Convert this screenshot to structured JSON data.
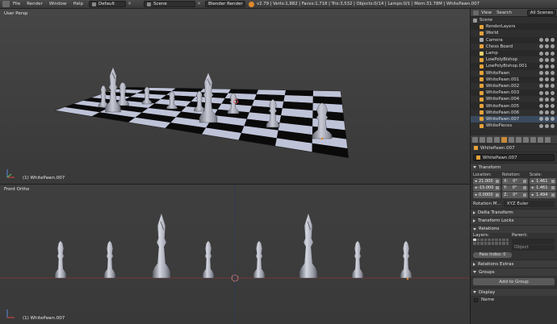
{
  "topbar": {
    "menus": [
      "File",
      "Render",
      "Window",
      "Help"
    ],
    "layout": "Default",
    "scene": "Scene",
    "engine": "Blender Render",
    "stats": "v2.79 | Verts:1,882 | Faces:1,718 | Tris:3,532 | Objects:0/14 | Lamps:0/1 | Mem:31.78M | WhitePawn.007"
  },
  "viewport_top": {
    "title": "User Persp",
    "footer": "(1) WhitePawn.007"
  },
  "viewport_bottom": {
    "title": "Front Ortho",
    "footer": "(1) WhitePawn.007"
  },
  "outliner": {
    "view_label": "View",
    "search_label": "Search",
    "scope": "All Scenes",
    "items": [
      {
        "label": "Scene",
        "kind": "scene",
        "indent": 0
      },
      {
        "label": "RenderLayers",
        "kind": "layer",
        "indent": 1
      },
      {
        "label": "World",
        "kind": "world",
        "indent": 1
      },
      {
        "label": "Camera",
        "kind": "cam",
        "indent": 1
      },
      {
        "label": "Chess Board",
        "kind": "obj",
        "indent": 1
      },
      {
        "label": "Lamp",
        "kind": "lamp",
        "indent": 1
      },
      {
        "label": "LowPolyBishop",
        "kind": "obj",
        "indent": 1
      },
      {
        "label": "LowPolyBishop.001",
        "kind": "obj",
        "indent": 1
      },
      {
        "label": "WhitePawn",
        "kind": "obj",
        "indent": 1
      },
      {
        "label": "WhitePawn.001",
        "kind": "obj",
        "indent": 1
      },
      {
        "label": "WhitePawn.002",
        "kind": "obj",
        "indent": 1
      },
      {
        "label": "WhitePawn.003",
        "kind": "obj",
        "indent": 1
      },
      {
        "label": "WhitePawn.004",
        "kind": "obj",
        "indent": 1
      },
      {
        "label": "WhitePawn.005",
        "kind": "obj",
        "indent": 1
      },
      {
        "label": "WhitePawn.006",
        "kind": "obj",
        "indent": 1
      },
      {
        "label": "WhitePawn.007",
        "kind": "obj",
        "indent": 1,
        "selected": true
      },
      {
        "label": "WhitePieces",
        "kind": "obj",
        "indent": 1
      }
    ]
  },
  "properties": {
    "breadcrumb": "WhitePawn.007",
    "name": "WhitePawn.007",
    "transform": {
      "header": "Transform",
      "loc_label": "Location:",
      "rot_label": "Rotation:",
      "scale_label": "Scale:",
      "location": [
        "21.000",
        "-15.000",
        "0.0000"
      ],
      "rotation": [
        "X:",
        "Y:",
        "Z:"
      ],
      "rotation_vals": [
        "0°",
        "0°",
        "0°"
      ],
      "scale": [
        "1.461",
        "1.461",
        "1.494"
      ],
      "rotation_mode_label": "Rotation M...",
      "rotation_mode": "XYZ Euler"
    },
    "delta_transform": "Delta Transform",
    "transform_locks": "Transform Locks",
    "relations": {
      "header": "Relations",
      "layers_label": "Layers:",
      "parent_label": "Parent:",
      "parent_type": "Object",
      "pass_index": "Pass Index:",
      "pass_value": "0"
    },
    "relations_extras": "Relations Extras",
    "groups": {
      "header": "Groups",
      "add_button": "Add to Group"
    },
    "display": {
      "header": "Display",
      "name_label": "Name"
    }
  },
  "colors": {
    "accent": "#e08a2b",
    "selection": "#3a4a5e",
    "board_light": "#bfc3d8",
    "board_dark": "#0a0a0a"
  }
}
